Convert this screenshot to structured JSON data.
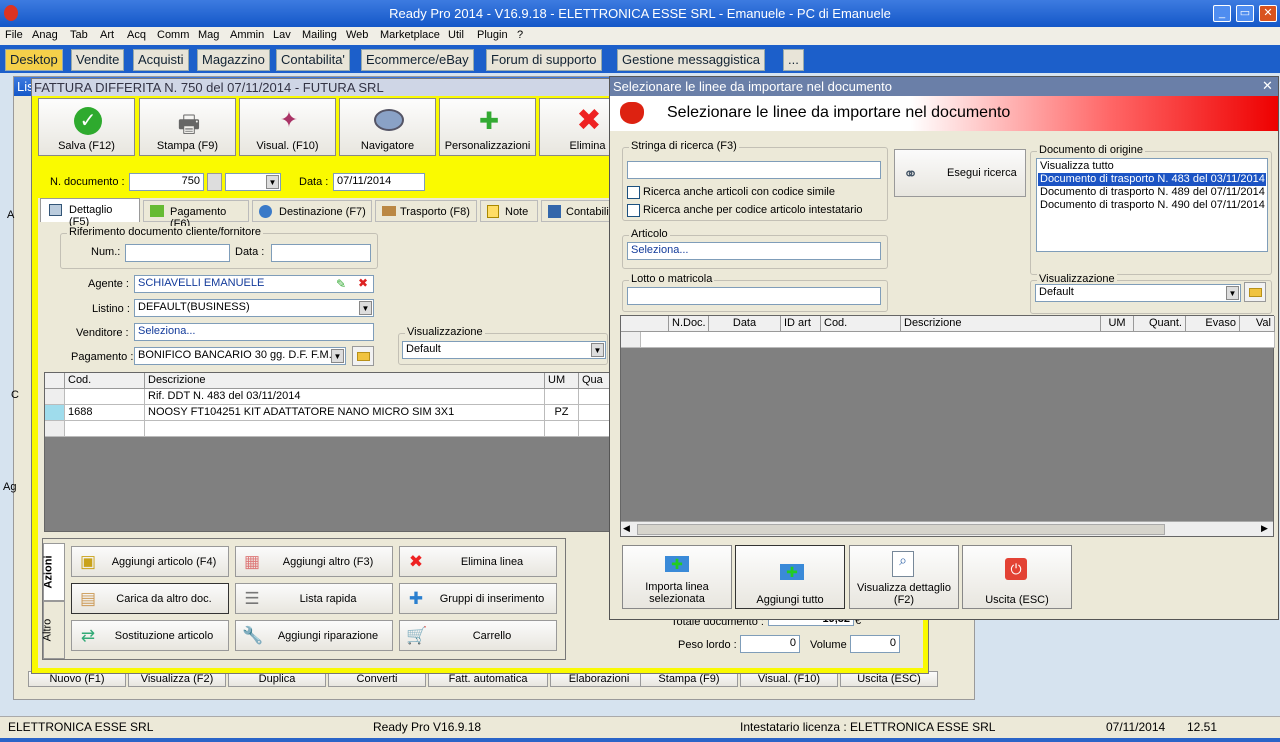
{
  "app": {
    "title": "Ready Pro 2014 - V16.9.18 - ELETTRONICA ESSE SRL - Emanuele - PC di Emanuele",
    "menu": [
      "File",
      "Anag",
      "Tab",
      "Art",
      "Acq",
      "Comm",
      "Mag",
      "Ammin",
      "Lav",
      "Mailing",
      "Web",
      "Marketplace",
      "Util",
      "Plugin",
      "?"
    ],
    "tabs": [
      "Desktop",
      "Vendite",
      "Acquisti",
      "Magazzino",
      "Contabilita'",
      "Ecommerce/eBay",
      "Forum di supporto",
      "Gestione messaggistica",
      "..."
    ]
  },
  "doc": {
    "behind_title": "Lis",
    "title": "FATTURA DIFFERITA N. 750 del 07/11/2014 - FUTURA SRL",
    "toolbar": [
      "Salva (F12)",
      "Stampa (F9)",
      "Visual. (F10)",
      "Navigatore",
      "Personalizzazioni",
      "Elimina"
    ],
    "ndoc_label": "N. documento :",
    "ndoc_value": "750",
    "data_label": "Data :",
    "data_value": "07/11/2014",
    "tabs": [
      "Dettaglio (F5)",
      "Pagamento (F6)",
      "Destinazione (F7)",
      "Trasporto (F8)",
      "Note",
      "Contabilita"
    ],
    "rif_caption": "Riferimento documento cliente/fornitore",
    "num_label": "Num.:",
    "data2_label": "Data :",
    "agente_label": "Agente :",
    "agente_value": "SCHIAVELLI EMANUELE",
    "listino_label": "Listino :",
    "listino_value": "DEFAULT(BUSINESS)",
    "venditore_label": "Venditore :",
    "venditore_value": "Seleziona...",
    "pagamento_label": "Pagamento :",
    "pagamento_value": "BONIFICO BANCARIO 30 gg. D.F. F.M.",
    "vis_caption": "Visualizzazione",
    "vis_value": "Default",
    "grid_headers": [
      "Cod.",
      "Descrizione",
      "UM",
      "Qua"
    ],
    "grid_rows": [
      {
        "cod": "",
        "desc": "Rif. DDT N. 483 del 03/11/2014",
        "um": ""
      },
      {
        "cod": "1688",
        "desc": "NOOSY FT104251 KIT ADATTATORE NANO MICRO SIM 3X1",
        "um": "PZ"
      },
      {
        "cod": "",
        "desc": "",
        "um": ""
      }
    ],
    "side_tabs": [
      "Azioni",
      "Altro"
    ],
    "actions": [
      "Aggiungi articolo (F4)",
      "Aggiungi altro (F3)",
      "Elimina linea",
      "Carica da altro doc.",
      "Lista rapida",
      "Gruppi di inserimento",
      "Sostituzione articolo",
      "Aggiungi riparazione",
      "Carrello"
    ],
    "totale_label": "Totale documento :",
    "totale_value": "19,32",
    "totale_cur": "€",
    "peso_label": "Peso lordo :",
    "peso_value": "0",
    "volume_label": "Volume :",
    "volume_value": "0",
    "bottom_btns": [
      "Nuovo (F1)",
      "Visualizza (F2)",
      "Duplica",
      "Converti",
      "Fatt. automatica",
      "Elaborazioni",
      "Stampa (F9)",
      "Visual. (F10)",
      "Uscita (ESC)"
    ]
  },
  "left_letters": [
    "A",
    "C",
    "Ag"
  ],
  "dialog": {
    "title": "Selezionare le linee da importare nel documento",
    "header": "Selezionare le linee da importare nel documento",
    "search_caption": "Stringa di ricerca (F3)",
    "search_button": "Esegui ricerca",
    "chk1": "Ricerca anche articoli con codice simile",
    "chk2": "Ricerca anche per codice articolo intestatario",
    "articolo_caption": "Articolo",
    "articolo_value": "Seleziona...",
    "lotto_caption": "Lotto o matricola",
    "origin_caption": "Documento di origine",
    "origin_items": [
      "Visualizza tutto",
      "Documento di trasporto N. 483 del 03/11/2014",
      "Documento di trasporto N. 489 del 07/11/2014",
      "Documento di trasporto N. 490 del 07/11/2014"
    ],
    "origin_selected": 1,
    "vis_caption": "Visualizzazione",
    "vis_value": "Default",
    "grid_headers": [
      "N.Doc.",
      "Data",
      "ID art",
      "Cod.",
      "Descrizione",
      "UM",
      "Quant.",
      "Evaso",
      "Val"
    ],
    "buttons": [
      "Importa linea selezionata",
      "Aggiungi tutto",
      "Visualizza dettaglio (F2)",
      "Uscita (ESC)"
    ]
  },
  "status": {
    "company": "ELETTRONICA ESSE SRL",
    "version": "Ready Pro V16.9.18",
    "license": "Intestatario licenza : ELETTRONICA ESSE SRL",
    "date": "07/11/2014",
    "time": "12.51"
  }
}
